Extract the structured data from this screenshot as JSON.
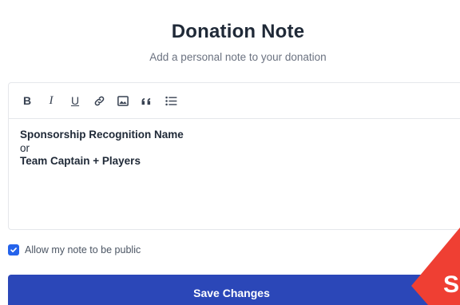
{
  "header": {
    "title": "Donation Note",
    "subtitle": "Add a personal note to your donation"
  },
  "toolbar": {
    "bold_label": "B",
    "italic_label": "I",
    "underline_label": "U",
    "icons": [
      "bold-icon",
      "italic-icon",
      "underline-icon",
      "link-icon",
      "image-icon",
      "quote-icon",
      "list-icon"
    ]
  },
  "editor": {
    "lines": [
      "Sponsorship Recognition Name",
      "or",
      "Team Captain + Players"
    ]
  },
  "public_option": {
    "checked": true,
    "label": "Allow my note to be public"
  },
  "actions": {
    "save_label": "Save Changes"
  },
  "corner_badge": {
    "letter": "S",
    "color": "#ef3f33"
  },
  "colors": {
    "primary": "#2b47b8",
    "checkbox": "#2563eb",
    "badge": "#ef3f33"
  }
}
